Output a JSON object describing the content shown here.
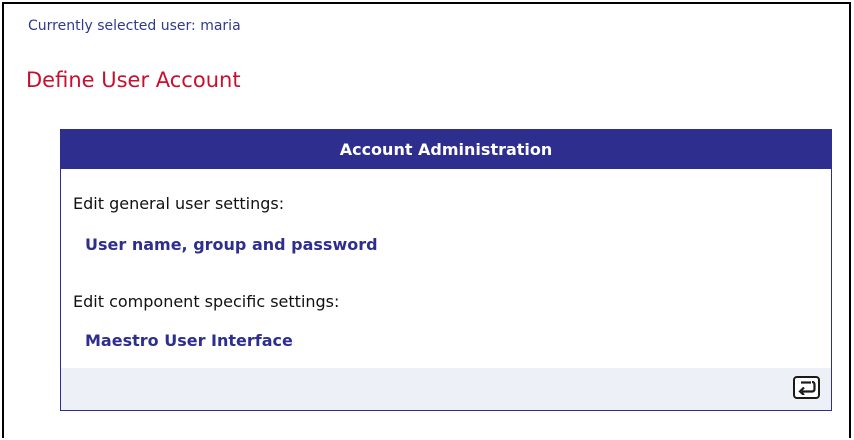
{
  "header": {
    "selected_user_text": "Currently selected user: maria",
    "page_title": "Define User Account"
  },
  "panel": {
    "title": "Account Administration",
    "general_label": "Edit general user settings:",
    "general_link": "User name, group and password",
    "component_label": "Edit component specific settings:",
    "component_link": "Maestro User Interface",
    "back_icon": "return-arrow-icon"
  },
  "colors": {
    "title_red": "#c8102e",
    "panel_blue": "#2e2e8f",
    "footer_bg": "#eef0f8"
  }
}
